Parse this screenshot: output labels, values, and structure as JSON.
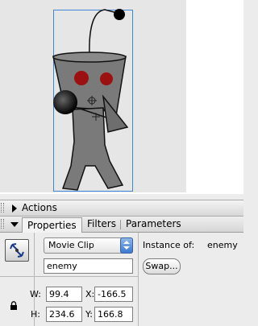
{
  "panels": {
    "actions_label": "Actions"
  },
  "tabs": [
    {
      "label": "Properties"
    },
    {
      "label": "Filters"
    },
    {
      "label": "Parameters"
    }
  ],
  "properties": {
    "symbol_type": "Movie Clip",
    "instance_name": "enemy",
    "instance_of_label": "Instance of:",
    "instance_of_value": "enemy",
    "swap_label": "Swap...",
    "w_label": "W:",
    "w_value": "99.4",
    "h_label": "H:",
    "h_value": "234.6",
    "x_label": "X:",
    "x_value": "-166.5",
    "y_label": "Y:",
    "y_value": "166.8"
  },
  "colors": {
    "stage_bg": "#e6e6e6",
    "selection": "#3f86d9",
    "robot_body": "#7a7a7a",
    "robot_eyes": "#9b1010"
  },
  "icons": {
    "symbol": "movie-clip-symbol-icon",
    "lock": "padlock-icon",
    "collapsed": "triangle-right-icon",
    "expanded": "triangle-down-icon"
  }
}
